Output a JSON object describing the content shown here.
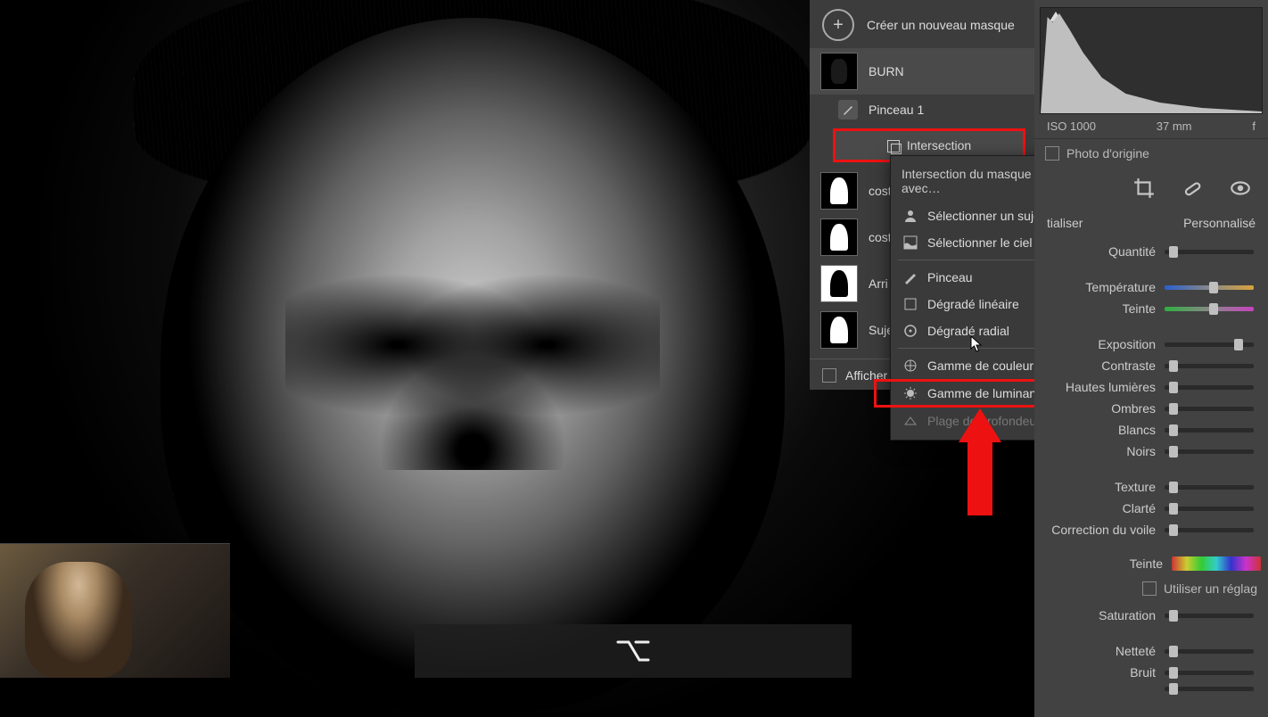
{
  "masks_panel": {
    "create_label": "Créer un nouveau masque",
    "selected_mask": "BURN",
    "brush_label": "Pinceau 1",
    "intersect_label": "Intersection",
    "other_masks": [
      "cost",
      "cost",
      "Arri",
      "Suje"
    ],
    "show_overlay_label": "Afficher l'"
  },
  "context_menu": {
    "title": "Intersection du masque avec…",
    "items": [
      {
        "label": "Sélectionner un sujet",
        "icon": "person"
      },
      {
        "label": "Sélectionner le ciel",
        "icon": "sky"
      },
      {
        "label": "Pinceau",
        "icon": "brush",
        "sep_before": true
      },
      {
        "label": "Dégradé linéaire",
        "icon": "linear"
      },
      {
        "label": "Dégradé radial",
        "icon": "radial"
      },
      {
        "label": "Gamme de couleur",
        "icon": "color",
        "sep_before": true
      },
      {
        "label": "Gamme de luminance",
        "icon": "luminance",
        "highlight": true
      },
      {
        "label": "Plage de profondeur",
        "icon": "depth",
        "disabled": true
      }
    ]
  },
  "right_panel": {
    "iso": "ISO 1000",
    "focal": "37 mm",
    "origin_label": "Photo d'origine",
    "reset_label": "tialiser",
    "preset_label": "Personnalisé",
    "sliders": [
      {
        "label": "Quantité",
        "pos": 5
      },
      {
        "label": "Température",
        "pos": 50,
        "grad": "temp",
        "group_gap": true
      },
      {
        "label": "Teinte",
        "pos": 50,
        "grad": "tint"
      },
      {
        "label": "Exposition",
        "pos": 78,
        "group_gap": true
      },
      {
        "label": "Contraste",
        "pos": 5
      },
      {
        "label": "Hautes lumières",
        "pos": 5
      },
      {
        "label": "Ombres",
        "pos": 5
      },
      {
        "label": "Blancs",
        "pos": 5
      },
      {
        "label": "Noirs",
        "pos": 5
      },
      {
        "label": "Texture",
        "pos": 5,
        "group_gap": true
      },
      {
        "label": "Clarté",
        "pos": 5
      },
      {
        "label": "Correction du voile",
        "pos": 5
      }
    ],
    "hue_label": "Teinte",
    "use_settings_label": "Utiliser un réglag",
    "bottom_sliders": [
      {
        "label": "Saturation",
        "pos": 5
      },
      {
        "label": "Netteté",
        "pos": 5,
        "group_gap": true
      },
      {
        "label": "Bruit",
        "pos": 5
      },
      {
        "label": "",
        "pos": 5
      }
    ]
  },
  "key_hint": "⌥"
}
